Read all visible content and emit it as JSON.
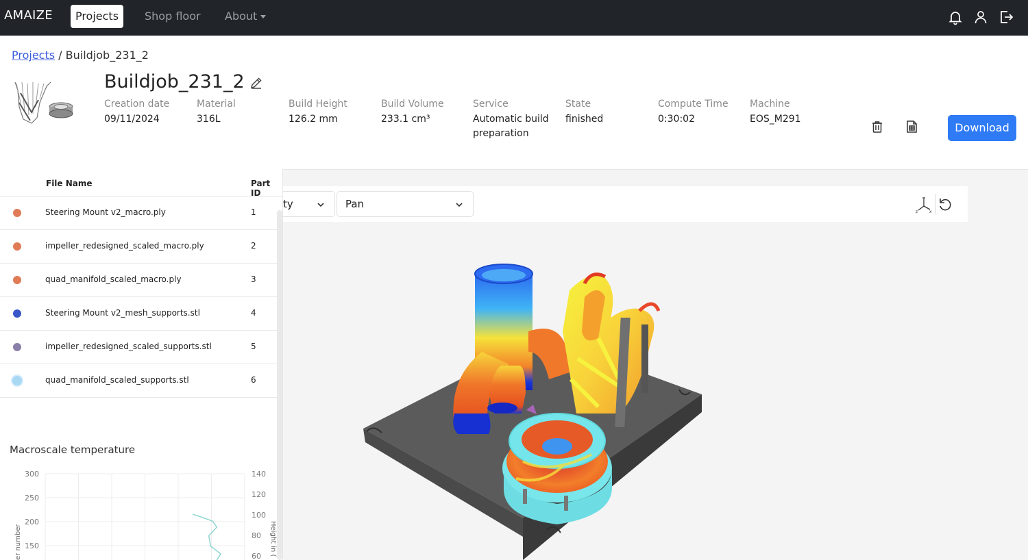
{
  "navbar": {
    "brand": "AMAIZE",
    "items": [
      "Projects",
      "Shop floor",
      "About"
    ]
  },
  "breadcrumb": {
    "link": "Projects",
    "separator": "/",
    "current": "Buildjob_231_2"
  },
  "job": {
    "title": "Buildjob_231_2",
    "meta": [
      {
        "key": "Creation date",
        "value": "09/11/2024"
      },
      {
        "key": "Material",
        "value": "316L"
      },
      {
        "key": "Build Height",
        "value": "126.2 mm"
      },
      {
        "key": "Build Volume",
        "value": "233.1 cm³"
      },
      {
        "key": "Service",
        "value": "Automatic build preparation"
      },
      {
        "key": "State",
        "value": "finished"
      },
      {
        "key": "Compute Time",
        "value": "0:30:02"
      },
      {
        "key": "Machine",
        "value": "EOS_M291"
      }
    ],
    "download_label": "Download"
  },
  "parts_table": {
    "headers": {
      "file": "File Name",
      "id": "Part ID"
    },
    "rows": [
      {
        "file": "Steering Mount v2_macro.ply",
        "id": "1",
        "color": "#e07b57"
      },
      {
        "file": "impeller_redesigned_scaled_macro.ply",
        "id": "2",
        "color": "#e07b57"
      },
      {
        "file": "quad_manifold_scaled_macro.ply",
        "id": "3",
        "color": "#e07b57"
      },
      {
        "file": "Steering Mount v2_mesh_supports.stl",
        "id": "4",
        "color": "#3a56c9"
      },
      {
        "file": "impeller_redesigned_scaled_supports.stl",
        "id": "5",
        "color": "#8a7fa8"
      },
      {
        "file": "quad_manifold_scaled_supports.stl",
        "id": "6",
        "color": "#a9d8f5"
      }
    ]
  },
  "chart_data": {
    "type": "line",
    "title": "Macroscale temperature",
    "left_axis": {
      "label": "er number",
      "ticks": [
        300,
        250,
        200,
        150
      ]
    },
    "right_axis": {
      "label": "Height in (",
      "ticks": [
        140,
        120,
        100,
        80,
        60
      ]
    },
    "series": [
      {
        "color": "#8fd6d0",
        "x": [
          0.74,
          0.78,
          0.84,
          0.86,
          0.82,
          0.83,
          0.88,
          0.86
        ],
        "y": [
          0.47,
          0.5,
          0.55,
          0.62,
          0.72,
          0.84,
          0.93,
          1.0
        ]
      }
    ]
  },
  "viewer": {
    "select1_text": "ty",
    "select2_text": "Pan"
  },
  "colors": {
    "navbar": "#212529",
    "accent": "#2f7bf5",
    "link": "#3b5bdb"
  }
}
